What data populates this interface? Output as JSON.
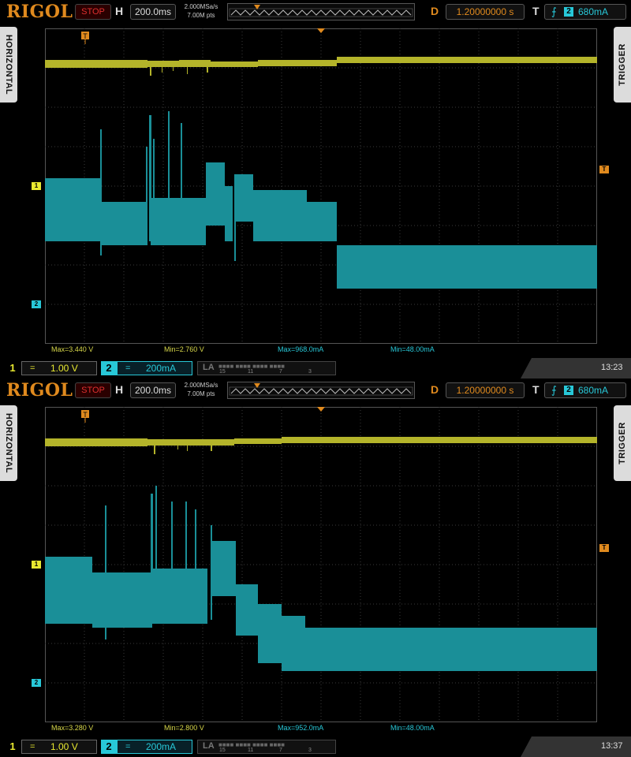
{
  "screens": [
    {
      "logo": "RIGOL",
      "run_status": "STOP",
      "h_label": "H",
      "timebase": "200.0ms",
      "sample_rate": "2.000MSa/s",
      "memory_depth": "7.00M pts",
      "d_label": "D",
      "delay": "1.20000000 s",
      "t_label": "T",
      "trigger_source": "2",
      "trigger_level": "680mA",
      "left_tab": "HORIZONTAL",
      "right_tab": "TRIGGER",
      "trigger_marker": "T",
      "ch1_marker": "1",
      "ch2_marker": "2",
      "measurements": {
        "ch1_max": "Max=3.440 V",
        "ch1_min": "Min=2.760 V",
        "ch2_max": "Max=968.0mA",
        "ch2_min": "Min=48.00mA"
      },
      "ch1": {
        "num": "1",
        "coupling": "=",
        "scale": "1.00 V"
      },
      "ch2": {
        "num": "2",
        "coupling": "=",
        "scale": "200mA"
      },
      "la": {
        "label": "LA",
        "nums": [
          "15",
          "11",
          "7",
          "3"
        ]
      },
      "clock": "13:23"
    },
    {
      "logo": "RIGOL",
      "run_status": "STOP",
      "h_label": "H",
      "timebase": "200.0ms",
      "sample_rate": "2.000MSa/s",
      "memory_depth": "7.00M pts",
      "d_label": "D",
      "delay": "1.20000000 s",
      "t_label": "T",
      "trigger_source": "2",
      "trigger_level": "680mA",
      "left_tab": "HORIZONTAL",
      "right_tab": "TRIGGER",
      "trigger_marker": "T",
      "ch1_marker": "1",
      "ch2_marker": "2",
      "measurements": {
        "ch1_max": "Max=3.280 V",
        "ch1_min": "Min=2.800 V",
        "ch2_max": "Max=952.0mA",
        "ch2_min": "Min=48.00mA"
      },
      "ch1": {
        "num": "1",
        "coupling": "=",
        "scale": "1.00 V"
      },
      "ch2": {
        "num": "2",
        "coupling": "=",
        "scale": "200mA"
      },
      "la": {
        "label": "LA",
        "nums": [
          "15",
          "11",
          "7",
          "3"
        ]
      },
      "clock": "13:37"
    }
  ],
  "colors": {
    "ch1": "#d8d84a",
    "ch2": "#1eaab4",
    "trigger": "#e08a1e",
    "grid": "#4a4a4a"
  }
}
